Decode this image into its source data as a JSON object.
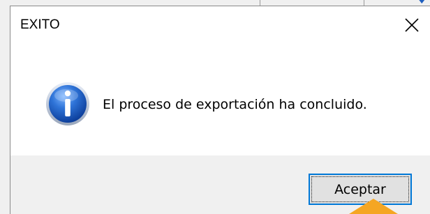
{
  "dialog": {
    "title": "EXITO",
    "message": "El proceso de exportación ha concluido.",
    "ok_label": "Aceptar",
    "icon": "info-icon",
    "close_icon": "close-icon"
  },
  "colors": {
    "focus_border": "#0078d7",
    "footer_bg": "#f0f0f0",
    "pointer_arrow": "#f5a623",
    "info_icon_blue": "#1c5ec4"
  }
}
